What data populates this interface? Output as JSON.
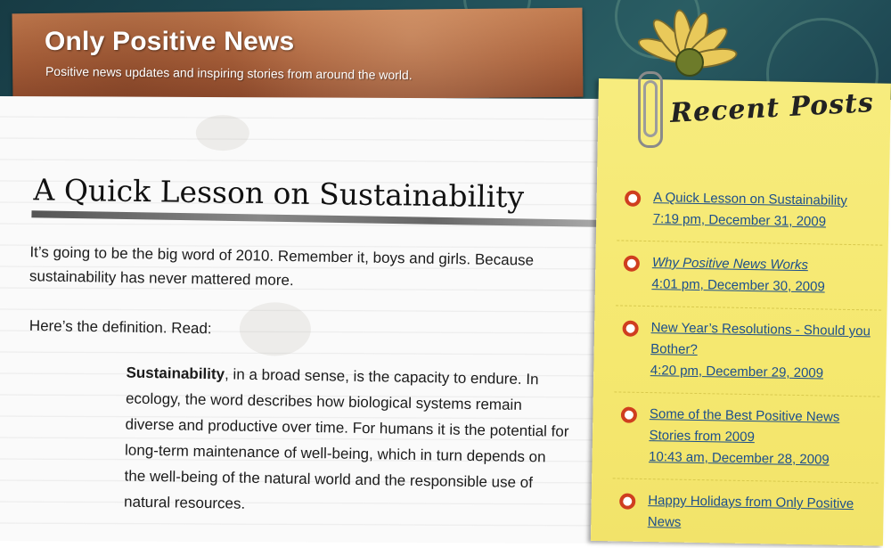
{
  "site": {
    "title": "Only Positive News",
    "tagline": "Positive news updates and inspiring stories from around the world."
  },
  "post": {
    "title": "A Quick Lesson on Sustainability",
    "intro": "It’s going to be the big word of 2010. Remember it, boys and girls. Because sustainability has never mattered more.",
    "definition_lead": "Here’s the definition. Read:",
    "quote_term": "Sustainability",
    "quote_body": ", in a broad sense, is the capacity to endure. In ecology, the word describes how biological systems remain diverse and productive over time. For humans it is the potential for long-term maintenance of well-being, which in turn depends on the well-being of the natural world and the responsible use of natural resources."
  },
  "sidebar": {
    "heading": "Recent Posts",
    "items": [
      {
        "title": "A Quick Lesson on Sustainability",
        "date": "7:19 pm, December 31, 2009"
      },
      {
        "title": "Why Positive News Works",
        "date": "4:01 pm, December 30, 2009"
      },
      {
        "title": "New Year’s Resolutions - Should you Bother?",
        "date": "4:20 pm, December 29, 2009"
      },
      {
        "title": "Some of the Best Positive News Stories from 2009",
        "date": "10:43 am, December 28, 2009"
      },
      {
        "title": "Happy Holidays from Only Positive News",
        "date": ""
      }
    ]
  },
  "colors": {
    "link": "#1d4f8c",
    "bullet": "#cf3e1f",
    "sticky_note": "#f5e86f",
    "header_label": "#a9603a"
  },
  "icons": {
    "bullet": "circle-bullet-icon",
    "clip": "paperclip-icon",
    "flower": "flower-icon"
  }
}
